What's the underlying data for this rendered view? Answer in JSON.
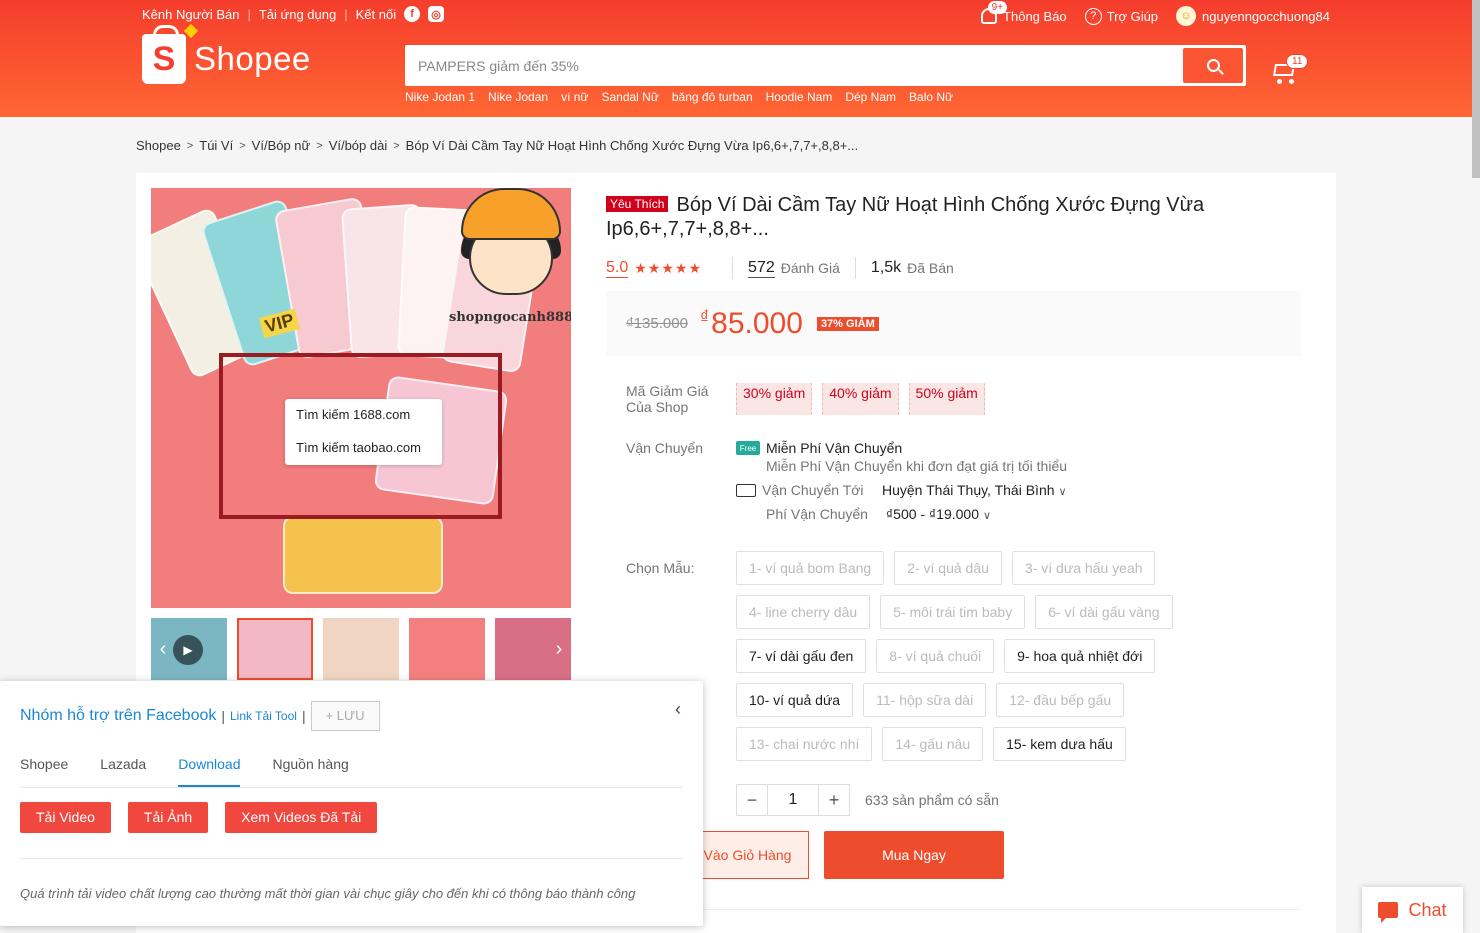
{
  "header": {
    "top_left": [
      "Kênh Người Bán",
      "Tải ứng dụng",
      "Kết nối"
    ],
    "notifications_badge": "9+",
    "notifications_label": "Thông Báo",
    "help_label": "Trợ Giúp",
    "username": "nguyenngocchuong84",
    "logo_text": "Shopee",
    "search_placeholder": "PAMPERS giảm đến 35%",
    "suggestions": [
      "Nike Jodan 1",
      "Nike Jodan",
      "ví nữ",
      "Sandal Nữ",
      "băng đô turban",
      "Hoodie Nam",
      "Dép Nam",
      "Balo Nữ"
    ],
    "cart_count": "11"
  },
  "breadcrumb": [
    "Shopee",
    "Túi Ví",
    "Ví/Bóp nữ",
    "Ví/bóp dài",
    "Bóp Ví Dài Cầm Tay Nữ Hoạt Hình Chống Xước Đựng Vừa Ip6,6+,7,7+,8,8+..."
  ],
  "product": {
    "badge": "Yêu Thích",
    "title": "Bóp Ví Dài Cầm Tay Nữ Hoạt Hình Chống Xước Đựng Vừa Ip6,6+,7,7+,8,8+...",
    "rating": "5.0",
    "stars": "★★★★★",
    "reviews_count": "572",
    "reviews_label": "Đánh Giá",
    "sold_count": "1,5k",
    "sold_label": "Đã Bán",
    "old_price": "₫135.000",
    "currency": "₫",
    "price": "85.000",
    "discount": "37% GIẢM",
    "watermark": "shopngocanh888",
    "vip_sticker": "VIP",
    "context_menu": [
      "Tìm kiếm 1688.com",
      "Tìm kiếm taobao.com"
    ]
  },
  "vouchers": {
    "label": "Mã Giảm Giá Của Shop",
    "items": [
      "30% giảm",
      "40% giảm",
      "50% giảm"
    ]
  },
  "shipping": {
    "label": "Vận Chuyển",
    "free_icon": "Free",
    "free_title": "Miễn Phí Vận Chuyển",
    "free_sub": "Miễn Phí Vận Chuyển khi đơn đạt giá trị tối thiểu",
    "to_label": "Vận Chuyển Tới",
    "to_value": "Huyện Thái Thụy, Thái Bình",
    "fee_label": "Phí Vận Chuyển",
    "fee_value": "₫500 - ₫19.000"
  },
  "variants": {
    "label": "Chọn Mẫu:",
    "items": [
      {
        "label": "1- ví quả bom Bang",
        "enabled": false
      },
      {
        "label": "2- ví quả dâu",
        "enabled": false
      },
      {
        "label": "3- ví dưa hấu yeah",
        "enabled": false
      },
      {
        "label": "4- line cherry dâu",
        "enabled": false
      },
      {
        "label": "5- môi trái tim baby",
        "enabled": false
      },
      {
        "label": "6- ví dài gấu vàng",
        "enabled": false
      },
      {
        "label": "7- ví dài gấu đen",
        "enabled": true
      },
      {
        "label": "8- ví quả chuối",
        "enabled": false
      },
      {
        "label": "9- hoa quả nhiệt đới",
        "enabled": true
      },
      {
        "label": "10- ví quả dứa",
        "enabled": true
      },
      {
        "label": "11- hộp sữa dài",
        "enabled": false
      },
      {
        "label": "12- đầu bếp gấu",
        "enabled": false
      },
      {
        "label": "13- chai nước nhí",
        "enabled": false
      },
      {
        "label": "14- gấu nâu",
        "enabled": false
      },
      {
        "label": "15- kem dưa hấu",
        "enabled": true
      }
    ]
  },
  "quantity": {
    "minus": "−",
    "value": "1",
    "plus": "+",
    "available": "633 sản phẩm có sẵn"
  },
  "buttons": {
    "add_to_cart": "Vào Giỏ Hàng",
    "buy_now": "Mua Ngay"
  },
  "tool_panel": {
    "fb_group": "Nhóm hỗ trợ trên Facebook",
    "sep": "|",
    "tool_link": "Link Tải Tool",
    "save": "+ LƯU",
    "close": "‹",
    "tabs": [
      "Shopee",
      "Lazada",
      "Download",
      "Nguồn hàng"
    ],
    "active_tab": "Download",
    "actions": [
      "Tải Video",
      "Tải Ảnh",
      "Xem Videos Đã Tải"
    ],
    "note": "Quá trình tải video chất lượng cao thường mất thời gian vài chục giây cho đến khi có thông báo thành công"
  },
  "chat": {
    "label": "Chat"
  },
  "colors": {
    "brand": "#ee4d2d",
    "link_blue": "#1a87d6"
  }
}
